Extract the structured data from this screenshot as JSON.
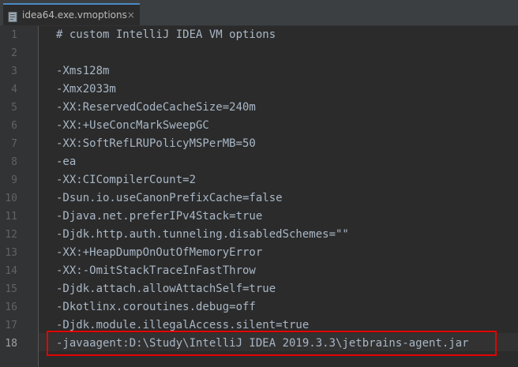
{
  "tab": {
    "title": "idea64.exe.vmoptions",
    "close_glyph": "×",
    "icon": "settings-file-icon"
  },
  "editor": {
    "current_line": 18,
    "lines": [
      {
        "num": "1",
        "text": "# custom IntelliJ IDEA VM options"
      },
      {
        "num": "2",
        "text": ""
      },
      {
        "num": "3",
        "text": "-Xms128m"
      },
      {
        "num": "4",
        "text": "-Xmx2033m"
      },
      {
        "num": "5",
        "text": "-XX:ReservedCodeCacheSize=240m"
      },
      {
        "num": "6",
        "text": "-XX:+UseConcMarkSweepGC"
      },
      {
        "num": "7",
        "text": "-XX:SoftRefLRUPolicyMSPerMB=50"
      },
      {
        "num": "8",
        "text": "-ea"
      },
      {
        "num": "9",
        "text": "-XX:CICompilerCount=2"
      },
      {
        "num": "10",
        "text": "-Dsun.io.useCanonPrefixCache=false"
      },
      {
        "num": "11",
        "text": "-Djava.net.preferIPv4Stack=true"
      },
      {
        "num": "12",
        "text": "-Djdk.http.auth.tunneling.disabledSchemes=\"\""
      },
      {
        "num": "13",
        "text": "-XX:+HeapDumpOnOutOfMemoryError"
      },
      {
        "num": "14",
        "text": "-XX:-OmitStackTraceInFastThrow"
      },
      {
        "num": "15",
        "text": "-Djdk.attach.allowAttachSelf=true"
      },
      {
        "num": "16",
        "text": "-Dkotlinx.coroutines.debug=off"
      },
      {
        "num": "17",
        "text": "-Djdk.module.illegalAccess.silent=true"
      },
      {
        "num": "18",
        "text": "-javaagent:D:\\Study\\IntelliJ IDEA 2019.3.3\\jetbrains-agent.jar"
      }
    ]
  },
  "colors": {
    "editor_bg": "#2b2b2b",
    "gutter_bg": "#313335",
    "text": "#a9b7c6",
    "line_number": "#606366",
    "highlight_box": "#e60000",
    "tab_accent": "#4a88c7"
  }
}
